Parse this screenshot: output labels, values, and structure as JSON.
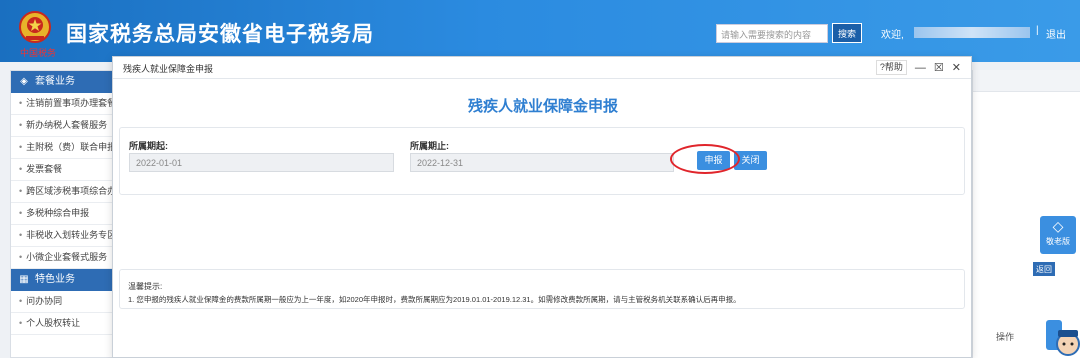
{
  "header": {
    "site_title": "国家税务总局安徽省电子税务局",
    "emblem_subtext": "中国税务",
    "search_placeholder": "请输入需要搜索的内容",
    "search_button": "搜索",
    "welcome": "欢迎,",
    "separator": "|",
    "logout": "退出"
  },
  "sidebar": {
    "section1": "套餐业务",
    "items1": [
      "注销前置事项办理套餐",
      "新办纳税人套餐服务",
      "主附税（费）联合申报",
      "发票套餐",
      "跨区域涉税事项综合办理",
      "多税种综合申报",
      "非税收入划转业务专区",
      "小微企业套餐式服务"
    ],
    "section2": "特色业务",
    "items2": [
      "问办协同",
      "个人股权转让"
    ]
  },
  "right_panel": {
    "float_label": "敬老版",
    "back_button": "返回",
    "op_label": "操作"
  },
  "modal": {
    "window_title": "残疾人就业保障金申报",
    "help": "?帮助",
    "minimize": "—",
    "maximize": "☒",
    "close": "✕",
    "form_title": "残疾人就业保障金申报",
    "start_label": "所属期起:",
    "start_value": "2022-01-01",
    "end_label": "所属期止:",
    "end_value": "2022-12-31",
    "submit_button": "申报",
    "close_button": "关闭",
    "tip_title": "温馨提示:",
    "tip_text": "1. 您申报的残疾人就业保障金的费款所属期一般应为上一年度，如2020年申报时，费款所属期应为2019.01.01-2019.12.31。如需修改费款所属期，请与主管税务机关联系确认后再申报。"
  },
  "colors": {
    "header_blue": "#2b8be0",
    "accent_blue": "#3b8fe0",
    "highlight_red": "#e0252b"
  }
}
